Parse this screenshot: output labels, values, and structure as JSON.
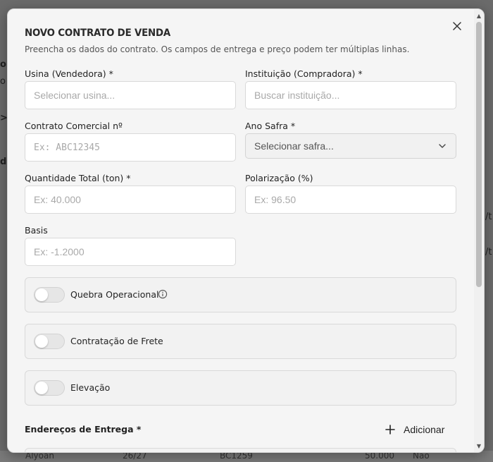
{
  "background": {
    "bottom_row": [
      "Alyoan",
      "26/27",
      "BC1259",
      "50.000",
      "Não"
    ],
    "side_fragments": [
      "o",
      "o",
      ">",
      "d",
      "/t",
      "/t"
    ]
  },
  "modal": {
    "title": "NOVO CONTRATO DE VENDA",
    "subtitle": "Preencha os dados do contrato. Os campos de entrega e preço podem ter múltiplas linhas.",
    "close_label": "✕"
  },
  "fields": {
    "usina": {
      "label": "Usina (Vendedora) *",
      "placeholder": "Selecionar usina..."
    },
    "instituicao": {
      "label": "Instituição (Compradora) *",
      "placeholder": "Buscar instituição..."
    },
    "contrato": {
      "label": "Contrato Comercial nº",
      "placeholder": "Ex: ABC12345"
    },
    "ano_safra": {
      "label": "Ano Safra *",
      "value": "Selecionar safra..."
    },
    "quantidade": {
      "label": "Quantidade Total (ton) *",
      "placeholder": "Ex: 40.000"
    },
    "polarizacao": {
      "label": "Polarização (%)",
      "placeholder": "Ex: 96.50"
    },
    "basis": {
      "label": "Basis",
      "placeholder": "Ex: -1.2000"
    }
  },
  "toggles": [
    {
      "label": "Quebra Operacional",
      "on": false,
      "has_info": true
    },
    {
      "label": "Contratação de Frete",
      "on": false,
      "has_info": false
    },
    {
      "label": "Elevação",
      "on": false,
      "has_info": false
    }
  ],
  "entregas": {
    "label": "Endereços de Entrega *",
    "add_label": "Adicionar"
  },
  "icons": {
    "close": "close-icon",
    "chevron": "chevron-down-icon",
    "info": "info-icon",
    "plus": "plus-icon"
  }
}
